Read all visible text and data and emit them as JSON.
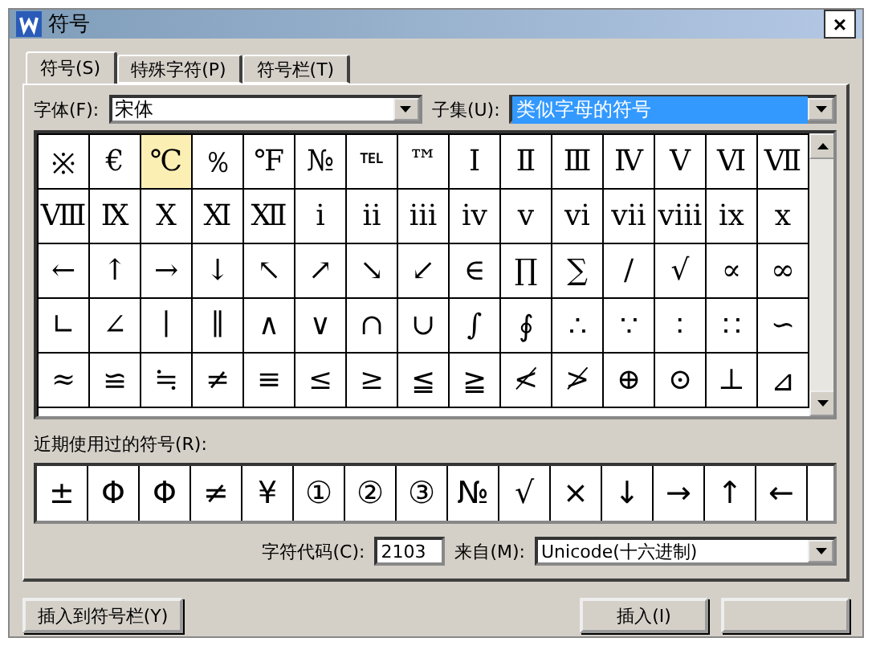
{
  "window": {
    "title": "符号",
    "close": "×"
  },
  "tabs": [
    {
      "label": "符号(S)",
      "selected": true
    },
    {
      "label": "特殊字符(P)",
      "selected": false
    },
    {
      "label": "符号栏(T)",
      "selected": false
    }
  ],
  "font": {
    "label": "字体(F):",
    "value": "宋体"
  },
  "subset": {
    "label": "子集(U):",
    "value": "类似字母的符号"
  },
  "symbols": [
    [
      {
        "s": "※",
        "selected": false
      },
      {
        "s": "€",
        "selected": false
      },
      {
        "s": "℃",
        "selected": true
      },
      {
        "s": "％",
        "selected": false
      },
      {
        "s": "℉",
        "selected": false
      },
      {
        "s": "№",
        "selected": false
      },
      {
        "s": "℡",
        "selected": false
      },
      {
        "s": "™",
        "selected": false
      },
      {
        "s": "Ⅰ",
        "selected": false
      },
      {
        "s": "Ⅱ",
        "selected": false
      },
      {
        "s": "Ⅲ",
        "selected": false
      },
      {
        "s": "Ⅳ",
        "selected": false
      },
      {
        "s": "Ⅴ",
        "selected": false
      },
      {
        "s": "Ⅵ",
        "selected": false
      },
      {
        "s": "Ⅶ",
        "selected": false
      }
    ],
    [
      {
        "s": "Ⅷ",
        "selected": false
      },
      {
        "s": "Ⅸ",
        "selected": false
      },
      {
        "s": "Ⅹ",
        "selected": false
      },
      {
        "s": "Ⅺ",
        "selected": false
      },
      {
        "s": "Ⅻ",
        "selected": false
      },
      {
        "s": "ⅰ",
        "selected": false
      },
      {
        "s": "ⅱ",
        "selected": false
      },
      {
        "s": "ⅲ",
        "selected": false
      },
      {
        "s": "ⅳ",
        "selected": false
      },
      {
        "s": "ⅴ",
        "selected": false
      },
      {
        "s": "ⅵ",
        "selected": false
      },
      {
        "s": "ⅶ",
        "selected": false
      },
      {
        "s": "ⅷ",
        "selected": false
      },
      {
        "s": "ⅸ",
        "selected": false
      },
      {
        "s": "ⅹ",
        "selected": false
      }
    ],
    [
      {
        "s": "←",
        "selected": false
      },
      {
        "s": "↑",
        "selected": false
      },
      {
        "s": "→",
        "selected": false
      },
      {
        "s": "↓",
        "selected": false
      },
      {
        "s": "↖",
        "selected": false
      },
      {
        "s": "↗",
        "selected": false
      },
      {
        "s": "↘",
        "selected": false
      },
      {
        "s": "↙",
        "selected": false
      },
      {
        "s": "∈",
        "selected": false
      },
      {
        "s": "∏",
        "selected": false
      },
      {
        "s": "∑",
        "selected": false
      },
      {
        "s": "∕",
        "selected": false
      },
      {
        "s": "√",
        "selected": false
      },
      {
        "s": "∝",
        "selected": false
      },
      {
        "s": "∞",
        "selected": false
      }
    ],
    [
      {
        "s": "∟",
        "selected": false
      },
      {
        "s": "∠",
        "selected": false
      },
      {
        "s": "∣",
        "selected": false
      },
      {
        "s": "∥",
        "selected": false
      },
      {
        "s": "∧",
        "selected": false
      },
      {
        "s": "∨",
        "selected": false
      },
      {
        "s": "∩",
        "selected": false
      },
      {
        "s": "∪",
        "selected": false
      },
      {
        "s": "∫",
        "selected": false
      },
      {
        "s": "∮",
        "selected": false
      },
      {
        "s": "∴",
        "selected": false
      },
      {
        "s": "∵",
        "selected": false
      },
      {
        "s": "∶",
        "selected": false
      },
      {
        "s": "∷",
        "selected": false
      },
      {
        "s": "∽",
        "selected": false
      }
    ],
    [
      {
        "s": "≈",
        "selected": false
      },
      {
        "s": "≌",
        "selected": false
      },
      {
        "s": "≒",
        "selected": false
      },
      {
        "s": "≠",
        "selected": false
      },
      {
        "s": "≡",
        "selected": false
      },
      {
        "s": "≤",
        "selected": false
      },
      {
        "s": "≥",
        "selected": false
      },
      {
        "s": "≦",
        "selected": false
      },
      {
        "s": "≧",
        "selected": false
      },
      {
        "s": "≮",
        "selected": false
      },
      {
        "s": "≯",
        "selected": false
      },
      {
        "s": "⊕",
        "selected": false
      },
      {
        "s": "⊙",
        "selected": false
      },
      {
        "s": "⊥",
        "selected": false
      },
      {
        "s": "⊿",
        "selected": false
      }
    ]
  ],
  "recent": {
    "label": "近期使用过的符号(R):",
    "items": [
      "±",
      "Φ",
      "Φ",
      "≠",
      "¥",
      "①",
      "②",
      "③",
      "№",
      "√",
      "×",
      "↓",
      "→",
      "↑",
      "←"
    ]
  },
  "code": {
    "label": "字符代码(C):",
    "value": "2103"
  },
  "from": {
    "label": "来自(M):",
    "value": "Unicode(十六进制)"
  },
  "buttons": [
    {
      "label": "插入到符号栏(Y)"
    },
    {
      "label": "插入(I)"
    }
  ]
}
